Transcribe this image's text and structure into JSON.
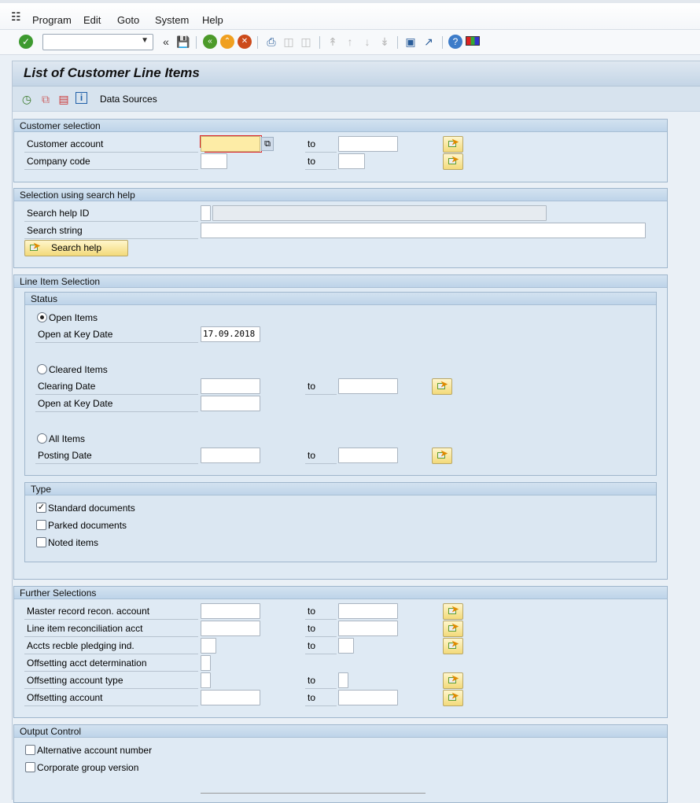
{
  "menu": [
    "Program",
    "Edit",
    "Goto",
    "System",
    "Help"
  ],
  "toolbar": {
    "command_field": "",
    "icons": [
      "enter-icon",
      "back-icon",
      "save-icon",
      "back-green-icon",
      "exit-icon",
      "cancel-icon",
      "print-icon",
      "find-icon",
      "find-next-icon",
      "first-page-icon",
      "prev-page-icon",
      "next-page-icon",
      "last-page-icon",
      "new-session-icon",
      "shortcut-icon",
      "help-icon",
      "customize-layout-icon"
    ]
  },
  "title": "List of Customer Line Items",
  "app_toolbar": {
    "data_sources": "Data Sources"
  },
  "customer_selection": {
    "header": "Customer selection",
    "rows": [
      {
        "label": "Customer account",
        "to": "to"
      },
      {
        "label": "Company code",
        "to": "to"
      }
    ]
  },
  "search_help": {
    "header": "Selection using search help",
    "id_label": "Search help ID",
    "string_label": "Search string",
    "button": "Search help"
  },
  "line_items": {
    "header": "Line Item Selection",
    "status": {
      "header": "Status",
      "open_items": "Open Items",
      "open_key_date_label": "Open at Key Date",
      "open_key_date_value": "17.09.2018",
      "cleared_items": "Cleared Items",
      "clearing_date_label": "Clearing Date",
      "cleared_key_date_label": "Open at Key Date",
      "all_items": "All Items",
      "posting_date_label": "Posting Date",
      "to": "to",
      "selected": "open_items"
    },
    "type": {
      "header": "Type",
      "items": [
        {
          "label": "Standard documents",
          "checked": true
        },
        {
          "label": "Parked documents",
          "checked": false
        },
        {
          "label": "Noted items",
          "checked": false
        }
      ]
    }
  },
  "further": {
    "header": "Further Selections",
    "rows": [
      {
        "label": "Master record recon. account",
        "to": "to"
      },
      {
        "label": "Line item reconciliation acct",
        "to": "to"
      },
      {
        "label": "Accts recble pledging ind.",
        "to": "to"
      },
      {
        "label": "Offsetting acct determination",
        "to": ""
      },
      {
        "label": "Offsetting account type",
        "to": "to"
      },
      {
        "label": "Offsetting account",
        "to": "to"
      }
    ]
  },
  "output": {
    "header": "Output Control",
    "items": [
      {
        "label": "Alternative account number",
        "checked": false
      },
      {
        "label": "Corporate group version",
        "checked": false
      }
    ]
  }
}
